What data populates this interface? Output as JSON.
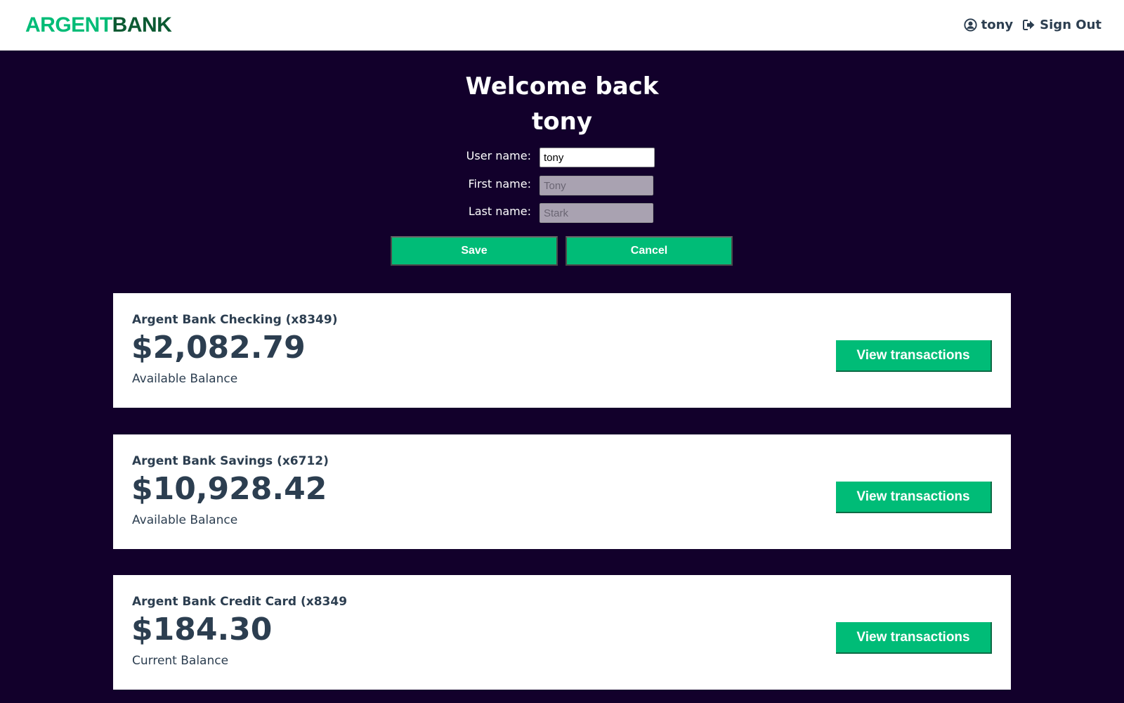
{
  "header": {
    "logo_part1": "ARGENT",
    "logo_part2": "BANK",
    "user_label": "tony",
    "signout_label": "Sign Out"
  },
  "welcome": {
    "line1": "Welcome back",
    "line2": "tony"
  },
  "form": {
    "username_label": "User name:",
    "username_value": "tony",
    "firstname_label": "First name:",
    "firstname_placeholder": "Tony",
    "lastname_label": "Last name:",
    "lastname_placeholder": "Stark",
    "save_label": "Save",
    "cancel_label": "Cancel"
  },
  "accounts": [
    {
      "title": "Argent Bank Checking (x8349)",
      "amount": "$2,082.79",
      "description": "Available Balance",
      "button_label": "View transactions"
    },
    {
      "title": "Argent Bank Savings (x6712)",
      "amount": "$10,928.42",
      "description": "Available Balance",
      "button_label": "View transactions"
    },
    {
      "title": "Argent Bank Credit Card (x8349",
      "amount": "$184.30",
      "description": "Current Balance",
      "button_label": "View transactions"
    }
  ],
  "colors": {
    "accent": "#00bc77",
    "background": "#12002b",
    "text": "#2c3e50",
    "logo_dark": "#0b5a32"
  },
  "icons": {
    "user": "user-circle-icon",
    "signout": "sign-out-icon"
  }
}
